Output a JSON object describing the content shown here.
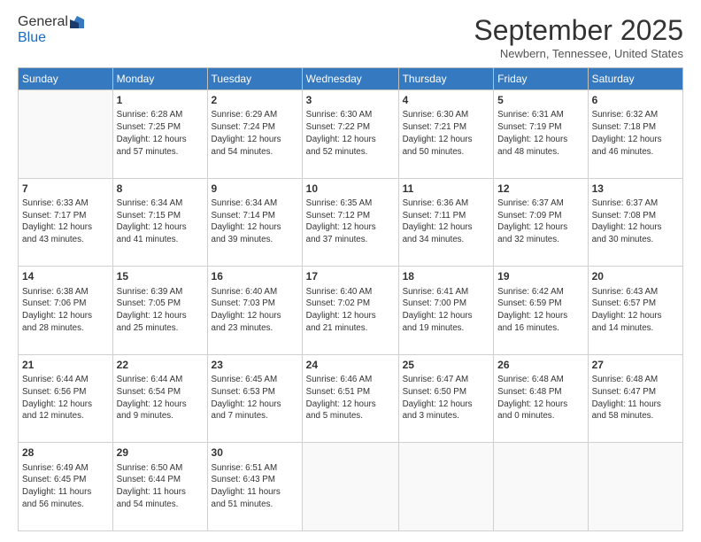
{
  "logo": {
    "general": "General",
    "blue": "Blue"
  },
  "header": {
    "month": "September 2025",
    "location": "Newbern, Tennessee, United States"
  },
  "days_of_week": [
    "Sunday",
    "Monday",
    "Tuesday",
    "Wednesday",
    "Thursday",
    "Friday",
    "Saturday"
  ],
  "weeks": [
    [
      {
        "day": "",
        "info": ""
      },
      {
        "day": "1",
        "info": "Sunrise: 6:28 AM\nSunset: 7:25 PM\nDaylight: 12 hours\nand 57 minutes."
      },
      {
        "day": "2",
        "info": "Sunrise: 6:29 AM\nSunset: 7:24 PM\nDaylight: 12 hours\nand 54 minutes."
      },
      {
        "day": "3",
        "info": "Sunrise: 6:30 AM\nSunset: 7:22 PM\nDaylight: 12 hours\nand 52 minutes."
      },
      {
        "day": "4",
        "info": "Sunrise: 6:30 AM\nSunset: 7:21 PM\nDaylight: 12 hours\nand 50 minutes."
      },
      {
        "day": "5",
        "info": "Sunrise: 6:31 AM\nSunset: 7:19 PM\nDaylight: 12 hours\nand 48 minutes."
      },
      {
        "day": "6",
        "info": "Sunrise: 6:32 AM\nSunset: 7:18 PM\nDaylight: 12 hours\nand 46 minutes."
      }
    ],
    [
      {
        "day": "7",
        "info": "Sunrise: 6:33 AM\nSunset: 7:17 PM\nDaylight: 12 hours\nand 43 minutes."
      },
      {
        "day": "8",
        "info": "Sunrise: 6:34 AM\nSunset: 7:15 PM\nDaylight: 12 hours\nand 41 minutes."
      },
      {
        "day": "9",
        "info": "Sunrise: 6:34 AM\nSunset: 7:14 PM\nDaylight: 12 hours\nand 39 minutes."
      },
      {
        "day": "10",
        "info": "Sunrise: 6:35 AM\nSunset: 7:12 PM\nDaylight: 12 hours\nand 37 minutes."
      },
      {
        "day": "11",
        "info": "Sunrise: 6:36 AM\nSunset: 7:11 PM\nDaylight: 12 hours\nand 34 minutes."
      },
      {
        "day": "12",
        "info": "Sunrise: 6:37 AM\nSunset: 7:09 PM\nDaylight: 12 hours\nand 32 minutes."
      },
      {
        "day": "13",
        "info": "Sunrise: 6:37 AM\nSunset: 7:08 PM\nDaylight: 12 hours\nand 30 minutes."
      }
    ],
    [
      {
        "day": "14",
        "info": "Sunrise: 6:38 AM\nSunset: 7:06 PM\nDaylight: 12 hours\nand 28 minutes."
      },
      {
        "day": "15",
        "info": "Sunrise: 6:39 AM\nSunset: 7:05 PM\nDaylight: 12 hours\nand 25 minutes."
      },
      {
        "day": "16",
        "info": "Sunrise: 6:40 AM\nSunset: 7:03 PM\nDaylight: 12 hours\nand 23 minutes."
      },
      {
        "day": "17",
        "info": "Sunrise: 6:40 AM\nSunset: 7:02 PM\nDaylight: 12 hours\nand 21 minutes."
      },
      {
        "day": "18",
        "info": "Sunrise: 6:41 AM\nSunset: 7:00 PM\nDaylight: 12 hours\nand 19 minutes."
      },
      {
        "day": "19",
        "info": "Sunrise: 6:42 AM\nSunset: 6:59 PM\nDaylight: 12 hours\nand 16 minutes."
      },
      {
        "day": "20",
        "info": "Sunrise: 6:43 AM\nSunset: 6:57 PM\nDaylight: 12 hours\nand 14 minutes."
      }
    ],
    [
      {
        "day": "21",
        "info": "Sunrise: 6:44 AM\nSunset: 6:56 PM\nDaylight: 12 hours\nand 12 minutes."
      },
      {
        "day": "22",
        "info": "Sunrise: 6:44 AM\nSunset: 6:54 PM\nDaylight: 12 hours\nand 9 minutes."
      },
      {
        "day": "23",
        "info": "Sunrise: 6:45 AM\nSunset: 6:53 PM\nDaylight: 12 hours\nand 7 minutes."
      },
      {
        "day": "24",
        "info": "Sunrise: 6:46 AM\nSunset: 6:51 PM\nDaylight: 12 hours\nand 5 minutes."
      },
      {
        "day": "25",
        "info": "Sunrise: 6:47 AM\nSunset: 6:50 PM\nDaylight: 12 hours\nand 3 minutes."
      },
      {
        "day": "26",
        "info": "Sunrise: 6:48 AM\nSunset: 6:48 PM\nDaylight: 12 hours\nand 0 minutes."
      },
      {
        "day": "27",
        "info": "Sunrise: 6:48 AM\nSunset: 6:47 PM\nDaylight: 11 hours\nand 58 minutes."
      }
    ],
    [
      {
        "day": "28",
        "info": "Sunrise: 6:49 AM\nSunset: 6:45 PM\nDaylight: 11 hours\nand 56 minutes."
      },
      {
        "day": "29",
        "info": "Sunrise: 6:50 AM\nSunset: 6:44 PM\nDaylight: 11 hours\nand 54 minutes."
      },
      {
        "day": "30",
        "info": "Sunrise: 6:51 AM\nSunset: 6:43 PM\nDaylight: 11 hours\nand 51 minutes."
      },
      {
        "day": "",
        "info": ""
      },
      {
        "day": "",
        "info": ""
      },
      {
        "day": "",
        "info": ""
      },
      {
        "day": "",
        "info": ""
      }
    ]
  ]
}
